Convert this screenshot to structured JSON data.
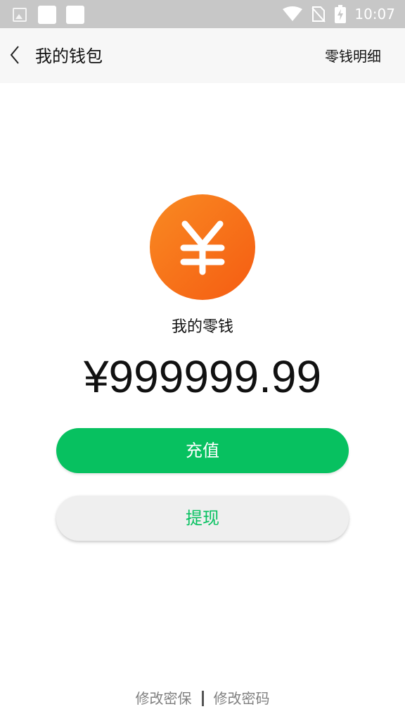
{
  "status_bar": {
    "time": "10:07",
    "icons": [
      "image-icon",
      "notification-square-icon",
      "notification-square-icon",
      "wifi-icon",
      "no-sim-icon",
      "battery-charging-icon"
    ]
  },
  "header": {
    "title": "我的钱包",
    "right_action": "零钱明细"
  },
  "wallet": {
    "coin_symbol": "¥",
    "label": "我的零钱",
    "amount": "¥999999.99"
  },
  "buttons": {
    "recharge": "充值",
    "withdraw": "提现"
  },
  "footer": {
    "security_question": "修改密保",
    "change_password": "修改密码"
  },
  "colors": {
    "accent_green": "#07c160",
    "coin_orange": "#f7731a",
    "status_bar": "#c7c7c7",
    "header_bg": "#f7f7f7"
  }
}
